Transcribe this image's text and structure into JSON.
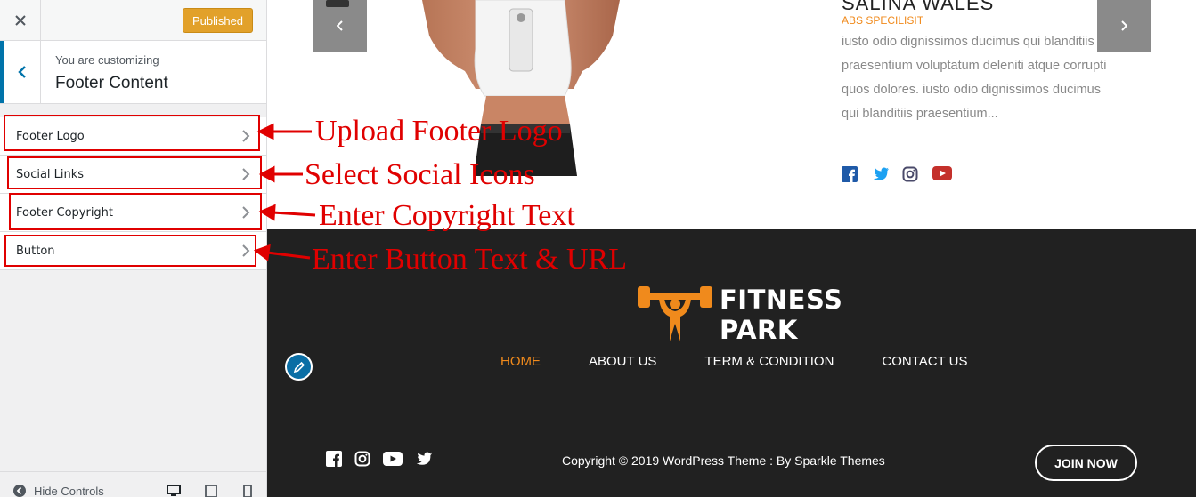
{
  "sidebar": {
    "publish_label": "Published",
    "customizing_label": "You are customizing",
    "section_title": "Footer Content",
    "items": [
      {
        "label": "Footer Logo"
      },
      {
        "label": "Social Links"
      },
      {
        "label": "Footer Copyright"
      },
      {
        "label": "Button"
      }
    ],
    "hide_controls_label": "Hide Controls"
  },
  "preview": {
    "trainer": {
      "name": "SALINA WALES",
      "role": "ABS SPECILISIT",
      "bio": "iusto odio dignissimos ducimus qui blanditiis praesentium voluptatum deleniti atque corrupti quos dolores. iusto odio dignissimos ducimus qui blanditiis praesentium..."
    },
    "footer": {
      "logo_line1": "FITNESS",
      "logo_line2": "PARK",
      "nav": [
        "HOME",
        "ABOUT US",
        "TERM & CONDITION",
        "CONTACT US"
      ],
      "copyright": "Copyright © 2019 WordPress Theme : By Sparkle Themes",
      "join_label": "JOIN NOW"
    }
  },
  "annotations": [
    "Upload Footer Logo",
    "Select Social Icons",
    "Enter Copyright Text",
    "Enter Button Text & URL"
  ],
  "colors": {
    "accent": "#f08a1c",
    "publish": "#e2a12a",
    "wp_blue": "#0073aa",
    "annotation_red": "#e00000",
    "footer_bg": "#212121"
  }
}
